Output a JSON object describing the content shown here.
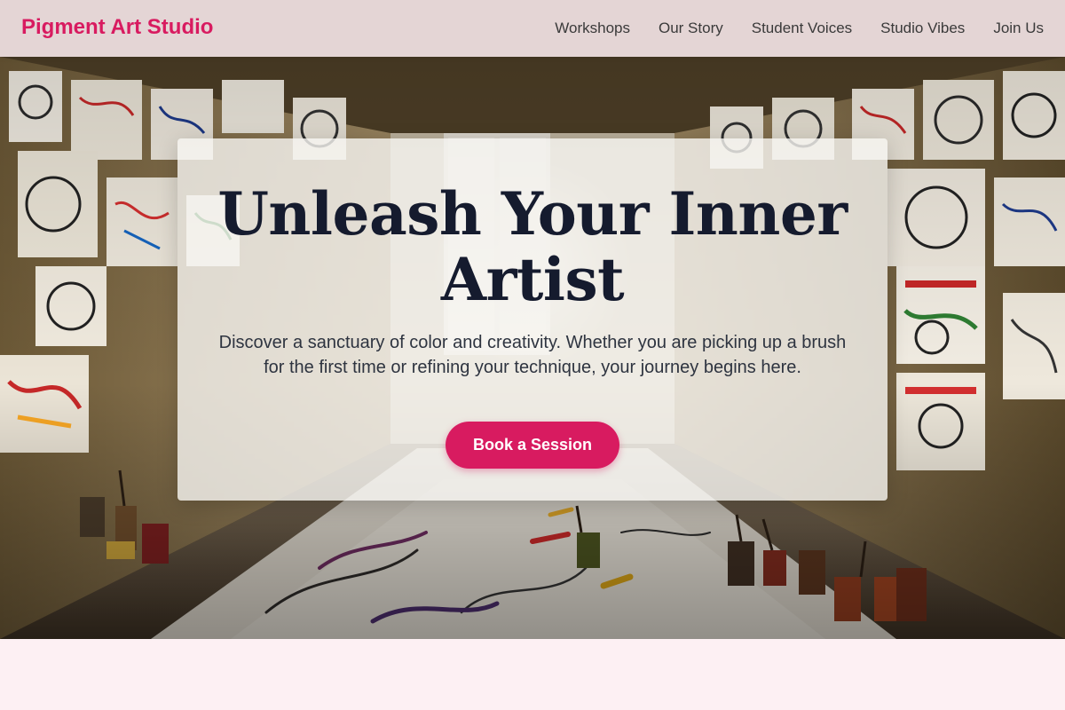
{
  "colors": {
    "brand": "#d81b60",
    "title_text": "#151b2e",
    "body_text": "#2e3440",
    "page_background": "#fdf0f3",
    "button_text": "#ffffff"
  },
  "header": {
    "brand_name": "Pigment Art Studio",
    "nav": [
      {
        "label": "Workshops"
      },
      {
        "label": "Our Story"
      },
      {
        "label": "Student Voices"
      },
      {
        "label": "Studio Vibes"
      },
      {
        "label": "Join Us"
      }
    ]
  },
  "hero": {
    "background_image": "art-studio-photo",
    "title": "Unleash Your Inner Artist",
    "subtitle": "Discover a sanctuary of color and creativity. Whether you are picking up a brush for the first time or refining your technique, your journey begins here.",
    "cta_label": "Book a Session"
  }
}
